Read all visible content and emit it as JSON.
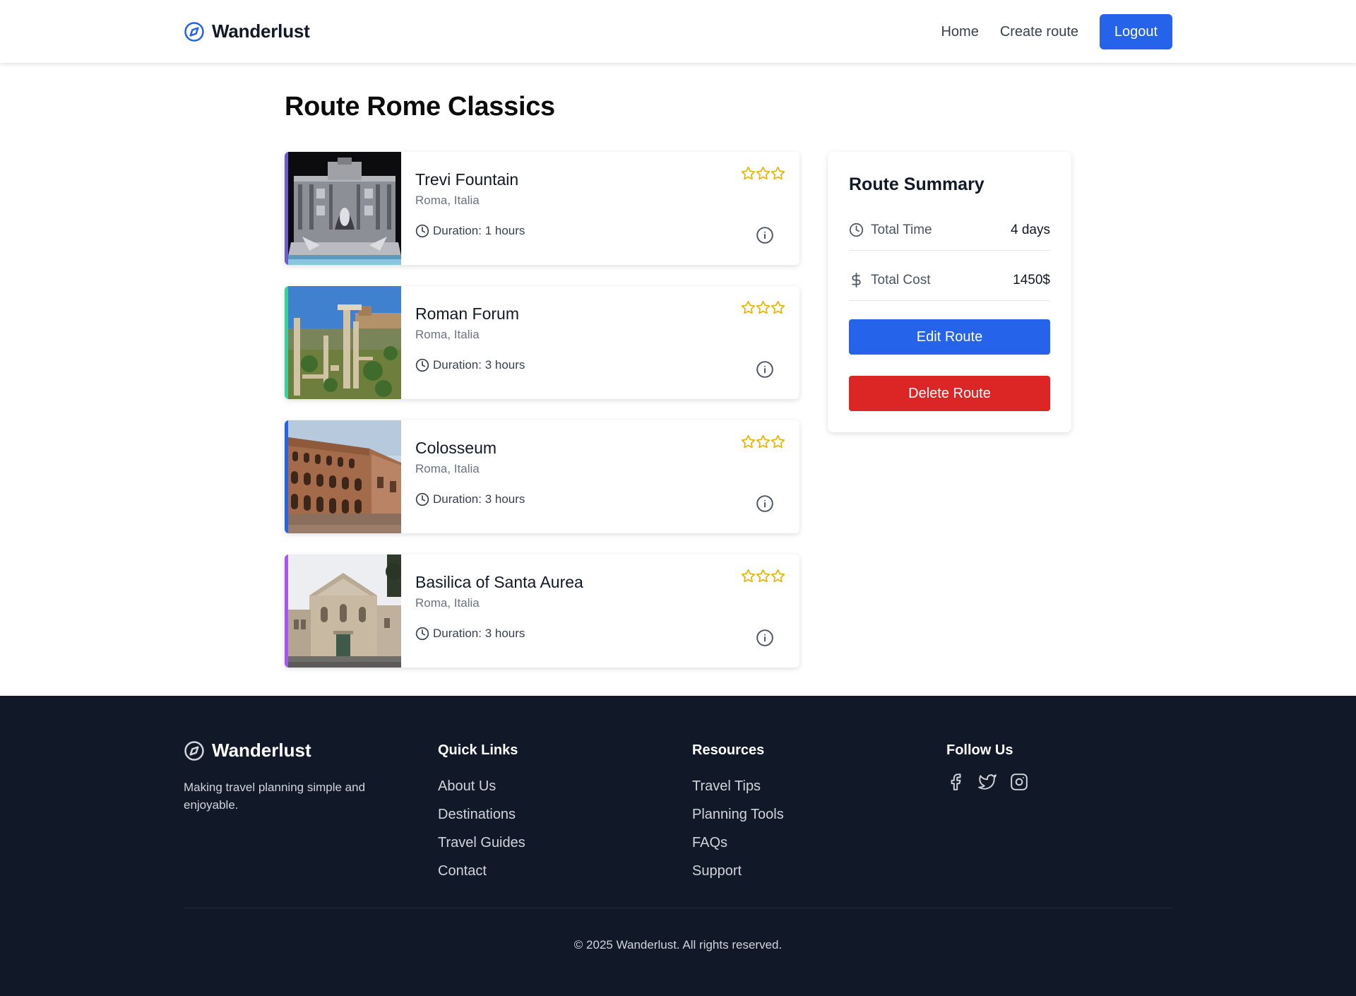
{
  "header": {
    "brand": "Wanderlust",
    "nav": {
      "home": "Home",
      "create_route": "Create route",
      "logout": "Logout"
    }
  },
  "page": {
    "title": "Route Rome Classics"
  },
  "stops": [
    {
      "name": "Trevi Fountain",
      "location": "Roma, Italia",
      "duration": "Duration: 1 hours",
      "rating": 0,
      "accent": "#6d5bd0"
    },
    {
      "name": "Roman Forum",
      "location": "Roma, Italia",
      "duration": "Duration: 3 hours",
      "rating": 0,
      "accent": "#34d399"
    },
    {
      "name": "Colosseum",
      "location": "Roma, Italia",
      "duration": "Duration: 3 hours",
      "rating": 0,
      "accent": "#2563eb"
    },
    {
      "name": "Basilica of Santa Aurea",
      "location": "Roma, Italia",
      "duration": "Duration: 3 hours",
      "rating": 0,
      "accent": "#a855f7"
    }
  ],
  "summary": {
    "title": "Route Summary",
    "total_time_label": "Total Time",
    "total_time_value": "4 days",
    "total_cost_label": "Total Cost",
    "total_cost_value": "1450$",
    "edit_label": "Edit Route",
    "delete_label": "Delete Route"
  },
  "footer": {
    "brand": "Wanderlust",
    "tagline": "Making travel planning simple and enjoyable.",
    "quick_links": {
      "title": "Quick Links",
      "items": [
        "About Us",
        "Destinations",
        "Travel Guides",
        "Contact"
      ]
    },
    "resources": {
      "title": "Resources",
      "items": [
        "Travel Tips",
        "Planning Tools",
        "FAQs",
        "Support"
      ]
    },
    "follow": {
      "title": "Follow Us",
      "icons": [
        "facebook-icon",
        "twitter-icon",
        "instagram-icon"
      ]
    },
    "copyright": "© 2025 Wanderlust. All rights reserved."
  },
  "colors": {
    "primary": "#2563eb",
    "danger": "#dc2626",
    "star": "#eab308",
    "footer_bg": "#111827"
  }
}
